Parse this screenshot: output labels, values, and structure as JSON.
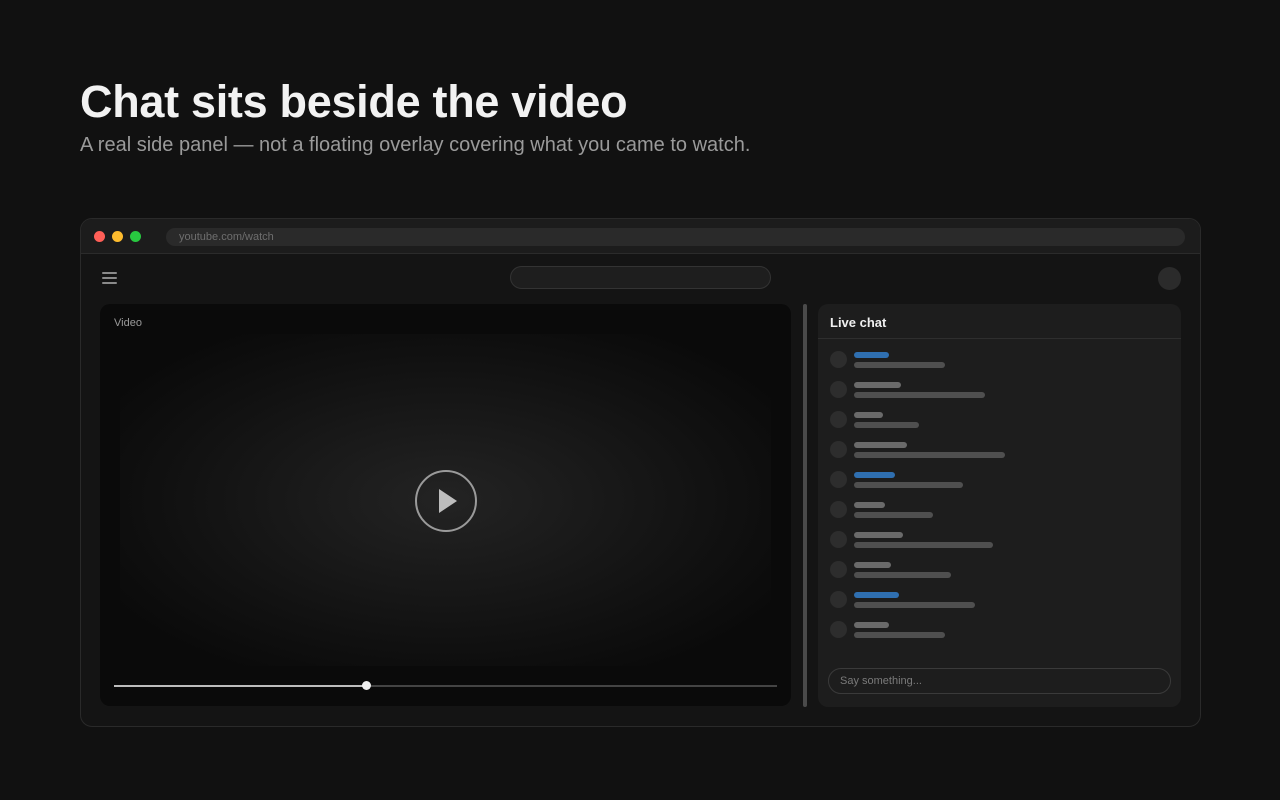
{
  "hero": {
    "title": "Chat sits beside the video",
    "subtitle": "A real side panel — not a floating overlay covering what you came to watch."
  },
  "browser": {
    "url": "youtube.com/watch"
  },
  "header": {
    "search_placeholder": "",
    "menu_icon": "hamburger-icon",
    "avatar_icon": "avatar-circle"
  },
  "video": {
    "label": "Video",
    "play_icon": "play-icon",
    "progress": 0.38
  },
  "chat": {
    "title": "Live chat",
    "input_placeholder": "Say something...",
    "colors": {
      "highlight_name": "#2f6fb0",
      "regular_name": "#6a6a6a",
      "text_line": "#4f4f4f"
    },
    "messages": [
      {
        "highlight": true
      },
      {
        "highlight": false
      },
      {
        "highlight": false
      },
      {
        "highlight": false
      },
      {
        "highlight": true
      },
      {
        "highlight": false
      },
      {
        "highlight": false
      },
      {
        "highlight": false
      },
      {
        "highlight": true
      },
      {
        "highlight": false
      }
    ]
  }
}
